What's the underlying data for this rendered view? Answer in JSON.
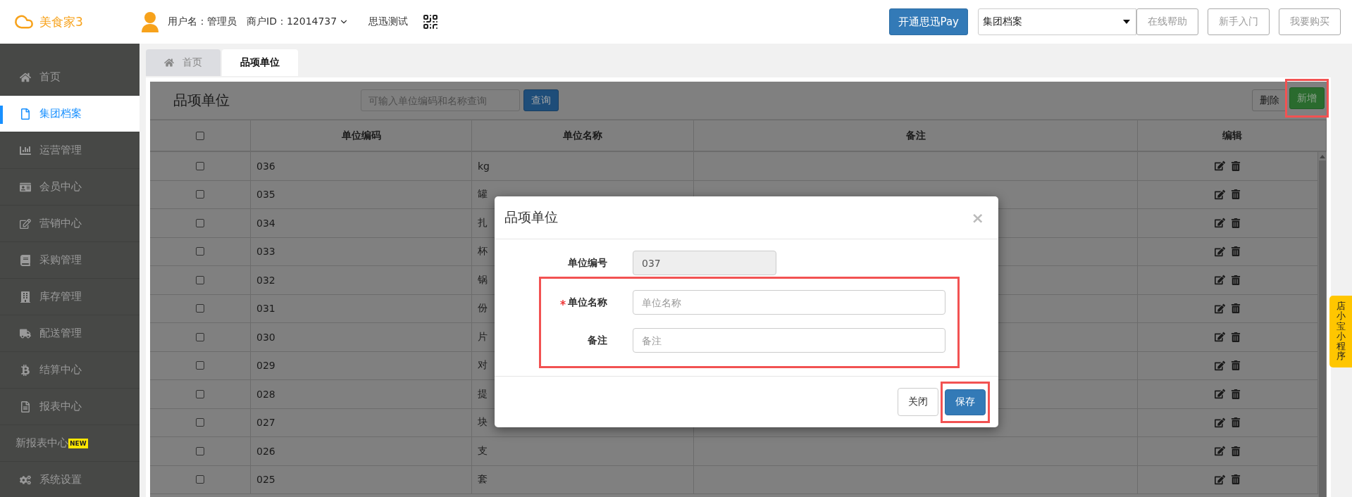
{
  "header": {
    "logo": "美食家3",
    "user_label": "用户名：管理员",
    "merchant_label": "商户ID：12014737",
    "store_name": "思迅测试",
    "pay_button": "开通思迅Pay",
    "archive_select": {
      "value": "集团档案"
    },
    "buttons": [
      "在线帮助",
      "新手入门",
      "我要购买"
    ]
  },
  "sidebar": {
    "items": [
      {
        "label": "首页",
        "selected": false
      },
      {
        "label": "集团档案",
        "selected": true
      },
      {
        "label": "运营管理",
        "selected": false
      },
      {
        "label": "会员中心",
        "selected": false
      },
      {
        "label": "营销中心",
        "selected": false
      },
      {
        "label": "采购管理",
        "selected": false
      },
      {
        "label": "库存管理",
        "selected": false
      },
      {
        "label": "配送管理",
        "selected": false
      },
      {
        "label": "结算中心",
        "selected": false
      },
      {
        "label": "报表中心",
        "selected": false
      },
      {
        "label": "新报表中心",
        "selected": false,
        "badge": "NEW"
      },
      {
        "label": "系统设置",
        "selected": false
      }
    ]
  },
  "tabs": [
    {
      "label": "首页",
      "selected": false
    },
    {
      "label": "品项单位",
      "selected": true
    }
  ],
  "panel": {
    "title": "品项单位",
    "search": {
      "placeholder": "可输入单位编码和名称查询"
    },
    "search_button": "查询",
    "buttons": [
      {
        "label": "删除",
        "kind": "default",
        "highlighted": false
      },
      {
        "label": "新增",
        "kind": "success",
        "highlighted": true
      }
    ]
  },
  "table": {
    "header_checked": false,
    "columns": [
      "单位编码",
      "单位名称",
      "备注",
      "编辑"
    ],
    "rows": [
      {
        "code": "036",
        "name": "kg",
        "checked": false
      },
      {
        "code": "035",
        "name": "罐",
        "checked": false
      },
      {
        "code": "034",
        "name": "扎",
        "checked": false
      },
      {
        "code": "033",
        "name": "杯",
        "checked": false
      },
      {
        "code": "032",
        "name": "锅",
        "checked": false
      },
      {
        "code": "031",
        "name": "份",
        "checked": false
      },
      {
        "code": "030",
        "name": "片",
        "checked": false
      },
      {
        "code": "029",
        "name": "对",
        "checked": false
      },
      {
        "code": "028",
        "name": "提",
        "checked": false
      },
      {
        "code": "027",
        "name": "块",
        "checked": false
      },
      {
        "code": "026",
        "name": "支",
        "checked": false
      },
      {
        "code": "025",
        "name": "套",
        "checked": false
      }
    ]
  },
  "dialog": {
    "title": "品项单位",
    "close": "×",
    "fields": [
      {
        "label": "单位编号",
        "value": "037",
        "disabled": true,
        "required": false,
        "highlighted": false
      },
      {
        "label": "单位名称",
        "placeholder": "单位名称",
        "disabled": false,
        "required": true,
        "highlighted": true
      },
      {
        "label": "备注",
        "placeholder": "备注",
        "disabled": false,
        "required": false,
        "highlighted": true
      }
    ],
    "buttons": [
      {
        "label": "关闭",
        "kind": "default",
        "highlighted": false
      },
      {
        "label": "保存",
        "kind": "primary",
        "highlighted": true
      }
    ]
  },
  "side_tab": {
    "label": "店小宝小程序"
  }
}
